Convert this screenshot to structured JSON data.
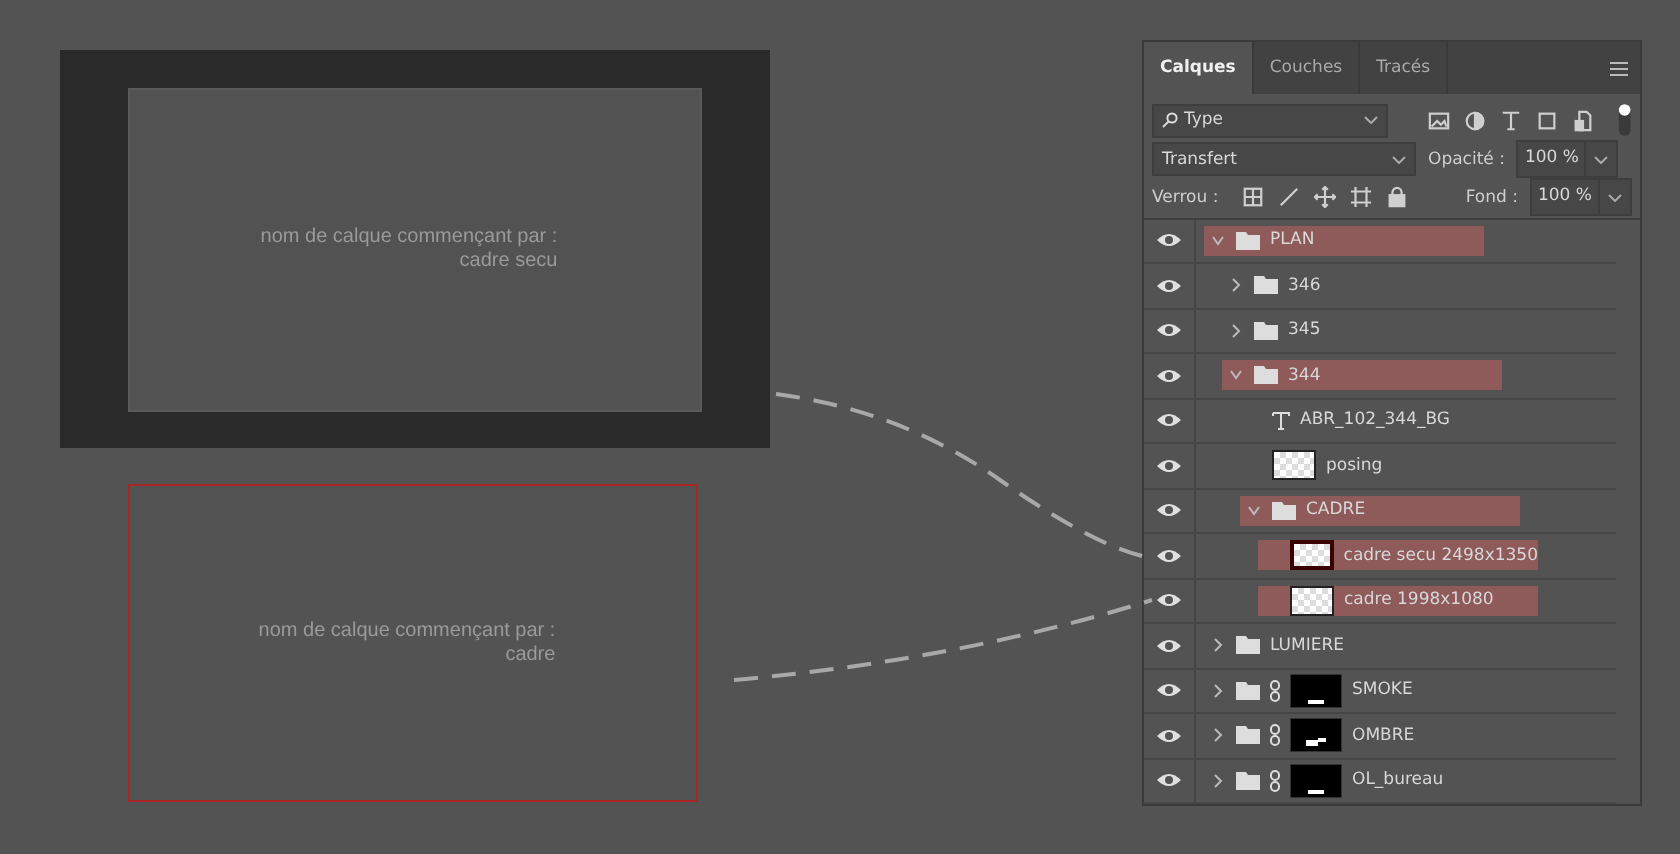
{
  "canvas": {
    "frames": [
      {
        "kind": "safe",
        "caption": "nom de calque commençant par :",
        "name": "cadre secu"
      },
      {
        "kind": "outline",
        "caption": "nom de calque commençant par :",
        "name": "cadre"
      }
    ]
  },
  "panel": {
    "tabs": [
      {
        "label": "Calques",
        "selected": true
      },
      {
        "label": "Couches",
        "selected": false
      },
      {
        "label": "Tracés",
        "selected": false
      }
    ],
    "filter": {
      "value": "Type"
    },
    "blend_mode": "Transfert",
    "opacity_label": "Opacité :",
    "opacity": "100 %",
    "lock_label": "Verrou :",
    "fill_label": "Fond :",
    "fill": "100 %",
    "layers": [
      {
        "kind": "group",
        "name": "PLAN",
        "visible": true,
        "selected": true,
        "expanded": true,
        "children": [
          {
            "kind": "group",
            "name": "346",
            "visible": true,
            "selected": false,
            "expanded": false
          },
          {
            "kind": "group",
            "name": "345",
            "visible": true,
            "selected": false,
            "expanded": false
          },
          {
            "kind": "group",
            "name": "344",
            "visible": true,
            "selected": true,
            "expanded": true,
            "children": [
              {
                "kind": "text",
                "name": "ABR_102_344_BG",
                "visible": true,
                "selected": false
              },
              {
                "kind": "pixel",
                "name": "posing",
                "visible": true,
                "selected": false,
                "active": false
              },
              {
                "kind": "group",
                "name": "CADRE",
                "visible": true,
                "selected": true,
                "expanded": true,
                "children": [
                  {
                    "kind": "pixel",
                    "name": "cadre secu 2498x1350",
                    "visible": true,
                    "selected": true,
                    "active": true
                  },
                  {
                    "kind": "pixel",
                    "name": "cadre 1998x1080",
                    "visible": true,
                    "selected": true,
                    "active": false
                  }
                ]
              }
            ]
          }
        ]
      },
      {
        "kind": "group",
        "name": "LUMIERE",
        "visible": true,
        "selected": false,
        "expanded": false
      },
      {
        "kind": "masked_group",
        "name": "SMOKE",
        "visible": true,
        "selected": false,
        "expanded": false
      },
      {
        "kind": "masked_group",
        "name": "OMBRE",
        "visible": true,
        "selected": false,
        "expanded": false
      },
      {
        "kind": "masked_group",
        "name": "OL_bureau",
        "visible": true,
        "selected": false,
        "expanded": false
      }
    ]
  }
}
